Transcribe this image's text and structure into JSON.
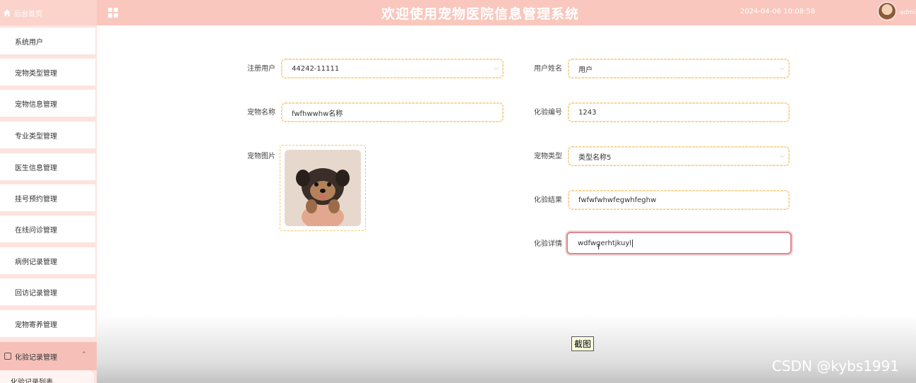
{
  "header": {
    "home_label": "后台首页",
    "title": "欢迎使用宠物医院信息管理系统",
    "datetime": "2024-04-06 10:08:58",
    "user": "admi"
  },
  "sidebar": {
    "items": [
      "系统用户",
      "宠物类型管理",
      "宠物信息管理",
      "专业类型管理",
      "医生信息管理",
      "挂号预约管理",
      "在线问诊管理",
      "病例记录管理",
      "回访记录管理",
      "宠物寄养管理"
    ],
    "group_label": "化验记录管理",
    "sub_item": "化验记录列表"
  },
  "form": {
    "reg_user_label": "注册用户",
    "reg_user_value": "44242-11111",
    "user_name_label": "用户姓名",
    "user_name_value": "用户",
    "pet_name_label": "宠物名称",
    "pet_name_value": "fwfhwwhw名称",
    "test_no_label": "化验编号",
    "test_no_value": "1243",
    "pet_image_label": "宠物图片",
    "pet_type_label": "宠物类型",
    "pet_type_value": "类型名称5",
    "test_result_label": "化验结果",
    "test_result_value": "fwfwfwhwfegwhfeghw",
    "test_detail_label": "化验详情",
    "test_detail_value": "wdfwgerhtjkuyl"
  },
  "tooltip": "截图",
  "watermark": "CSDN @kybs1991",
  "colors": {
    "header": "#f9c7bd",
    "sidebar_bg": "#fde3de",
    "field_border": "#f4c46a",
    "active_border": "#d78b93"
  }
}
